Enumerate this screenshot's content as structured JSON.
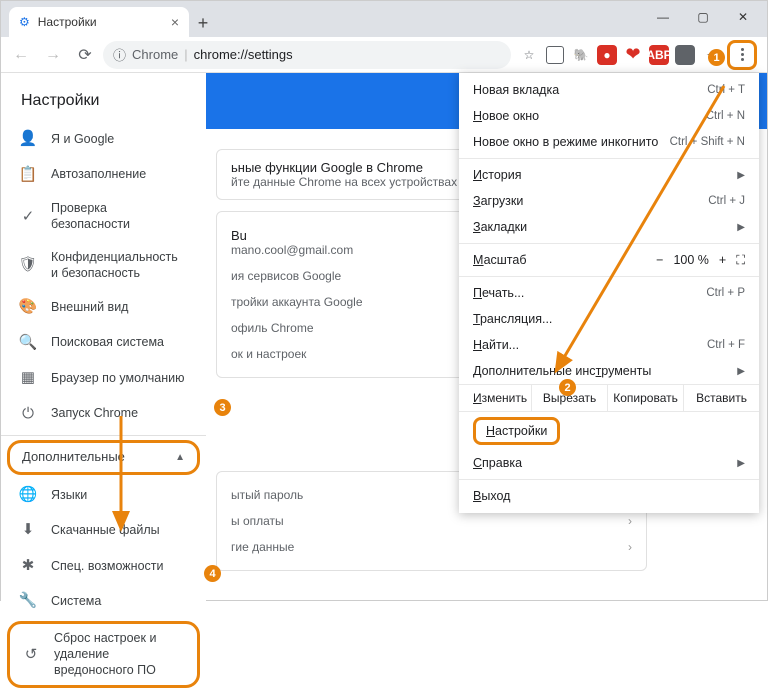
{
  "window": {
    "tab_title": "Настройки",
    "minimize": "—",
    "maximize": "▢",
    "close": "✕"
  },
  "url": {
    "prefix": "Chrome",
    "path": "chrome://settings"
  },
  "ext": {
    "abp": "ABP",
    "red": "●"
  },
  "settings_title": "Настройки",
  "sidebar": {
    "items": [
      {
        "label": "Я и Google"
      },
      {
        "label": "Автозаполнение"
      },
      {
        "label": "Проверка безопасности"
      },
      {
        "label": "Конфиденциальность и безопасность"
      },
      {
        "label": "Внешний вид"
      },
      {
        "label": "Поисковая система"
      },
      {
        "label": "Браузер по умолчанию"
      },
      {
        "label": "Запуск Chrome"
      }
    ],
    "advanced": "Дополнительные",
    "adv_items": [
      {
        "label": "Языки"
      },
      {
        "label": "Скачанные файлы"
      },
      {
        "label": "Спец. возможности"
      },
      {
        "label": "Система"
      },
      {
        "label": "Сброс настроек и удаление вредоносного ПО"
      }
    ]
  },
  "content": {
    "line1": "ьные функции Google в Chrome",
    "line2": "йте данные Chrome на всех устройствах",
    "user": "Bu",
    "email": "mano.cool@gmail.com",
    "row3": "ия сервисов Google",
    "row4": "тройки аккаунта Google",
    "row5": "офиль Chrome",
    "row6": "ок и настроек",
    "row7": "ытый пароль",
    "row8": "ы оплаты",
    "row9": "гие данные"
  },
  "menu": {
    "new_tab": {
      "l": "Новая вкладка",
      "s": "Ctrl + T"
    },
    "new_win": {
      "l": "Новое окно",
      "s": "Ctrl + N"
    },
    "incognito": {
      "l": "Новое окно в режиме инкогнито",
      "s": "Ctrl + Shift + N"
    },
    "history": {
      "l": "История"
    },
    "downloads": {
      "l": "Загрузки",
      "s": "Ctrl + J"
    },
    "bookmarks": {
      "l": "Закладки"
    },
    "zoom": {
      "l": "Масштаб",
      "val": "100 %",
      "minus": "−",
      "plus": "+"
    },
    "print": {
      "l": "Печать...",
      "s": "Ctrl + P"
    },
    "cast": {
      "l": "Трансляция..."
    },
    "find": {
      "l": "Найти...",
      "s": "Ctrl + F"
    },
    "more_tools": {
      "l": "Дополнительные инструменты"
    },
    "edit": {
      "l": "Изменить",
      "cut": "Вырезать",
      "copy": "Копировать",
      "paste": "Вставить"
    },
    "settings": {
      "l": "Настройки"
    },
    "help": {
      "l": "Справка"
    },
    "exit": {
      "l": "Выход"
    }
  },
  "badges": {
    "b1": "1",
    "b2": "2",
    "b3": "3",
    "b4": "4"
  }
}
